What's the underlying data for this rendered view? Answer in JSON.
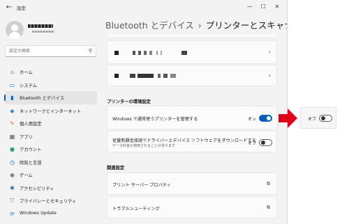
{
  "window": {
    "title": "設定"
  },
  "user": {
    "name_redacted": true
  },
  "search": {
    "placeholder": "設定の検索",
    "value": ""
  },
  "nav": [
    {
      "label": "ホーム",
      "icon": "home-icon",
      "color": "#c2703d"
    },
    {
      "label": "システム",
      "icon": "system-icon",
      "color": "#0078d4"
    },
    {
      "label": "Bluetooth とデバイス",
      "icon": "bluetooth-devices-icon",
      "color": "#0067c0"
    },
    {
      "label": "ネットワークとインターネット",
      "icon": "network-icon",
      "color": "#2e8bd8"
    },
    {
      "label": "個人用設定",
      "icon": "paintbrush-icon",
      "color": "#c27a2a"
    },
    {
      "label": "アプリ",
      "icon": "apps-icon",
      "color": "#555555"
    },
    {
      "label": "アカウント",
      "icon": "account-icon",
      "color": "#2aa36b"
    },
    {
      "label": "時刻と言語",
      "icon": "time-language-icon",
      "color": "#0078d4"
    },
    {
      "label": "ゲーム",
      "icon": "gaming-icon",
      "color": "#6b6b6b"
    },
    {
      "label": "アクセシビリティ",
      "icon": "accessibility-icon",
      "color": "#1a6fc2"
    },
    {
      "label": "プライバシーとセキュリティ",
      "icon": "shield-icon",
      "color": "#5a6a7a"
    },
    {
      "label": "Windows Update",
      "icon": "update-icon",
      "color": "#0078d4"
    }
  ],
  "header": {
    "breadcrumb": "Bluetooth とデバイス",
    "separator": "›",
    "title": "プリンターとスキャナー"
  },
  "printers": [
    {
      "name_redacted": true
    },
    {
      "name_redacted": true
    }
  ],
  "printer_settings": {
    "heading": "プリンターの環境設定",
    "default_printer": {
      "label": "Windows で通常使うプリンターを管理する",
      "state": "オン",
      "on": true
    },
    "metered": {
      "label": "従量制課金接続でドライバーとデバイス ソフトウェアをダウンロードする",
      "sublabel": "データ料金が適用されることがあります",
      "state": "オフ",
      "on": false
    }
  },
  "related": {
    "heading": "関連設定",
    "items": [
      {
        "label": "プリント サーバー プロパティ"
      },
      {
        "label": "トラブルシューティング"
      }
    ]
  },
  "callout": {
    "state": "オフ",
    "on": false
  },
  "colors": {
    "accent": "#005fb8",
    "arrow": "#e0001b"
  }
}
